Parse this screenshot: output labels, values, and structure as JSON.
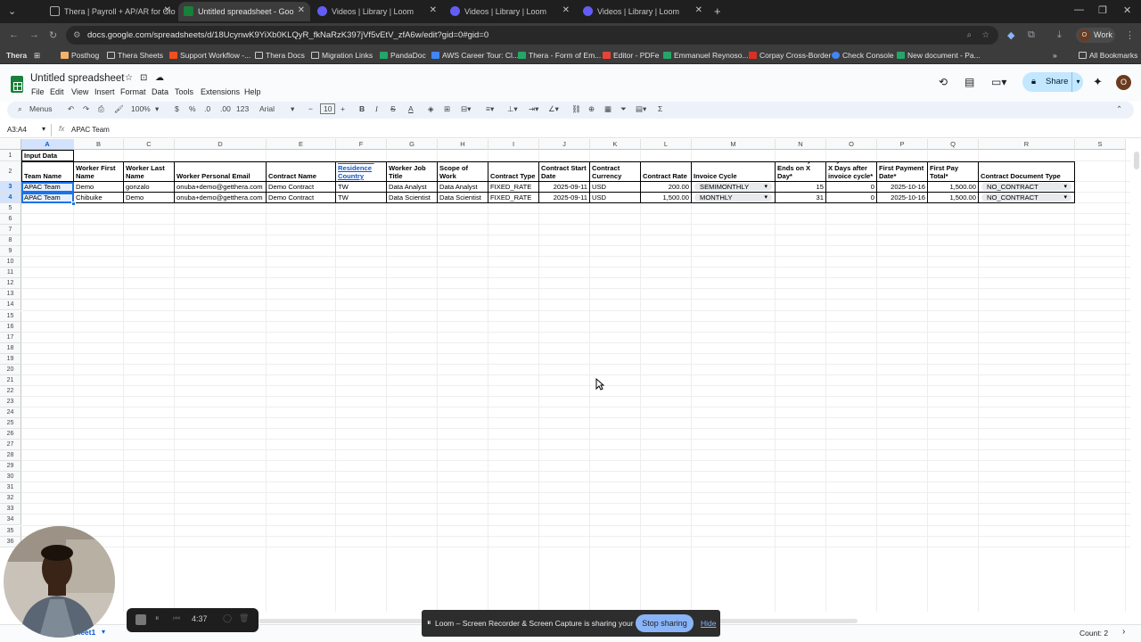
{
  "browser": {
    "tabs": [
      {
        "title": "Thera | Payroll + AP/AR for Glo",
        "active": false
      },
      {
        "title": "Untitled spreadsheet - Goo",
        "active": true
      },
      {
        "title": "Videos | Library | Loom",
        "active": false
      },
      {
        "title": "Videos | Library | Loom",
        "active": false
      },
      {
        "title": "Videos | Library | Loom",
        "active": false
      }
    ],
    "url": "docs.google.com/spreadsheets/d/18UcynwK9YiXb0KLQyR_fkNaRzK397jVf5vEtV_zfA6w/edit?gid=0#gid=0",
    "profile_label": "Work",
    "bookmarks": [
      "Posthog",
      "Thera Sheets",
      "Support Workflow -...",
      "Thera Docs",
      "Migration Links",
      "PandaDoc",
      "AWS Career Tour: Cl...",
      "Thera - Form of Em...",
      "Editor - PDFe",
      "Emmanuel Reynoso...",
      "Corpay Cross-Border",
      "Check Console",
      "New document - Pa..."
    ],
    "bookmarks_prefix": "Thera",
    "all_bookmarks": "All Bookmarks"
  },
  "sheets": {
    "doc_title": "Untitled spreadsheet",
    "menus": [
      "File",
      "Edit",
      "View",
      "Insert",
      "Format",
      "Data",
      "Tools",
      "Extensions",
      "Help"
    ],
    "share_label": "Share",
    "avatar_letter": "O",
    "toolbar": {
      "menus_label": "Menus",
      "zoom": "100%",
      "currency": "$",
      "percent": "%",
      "dec_decrease": ".0",
      "dec_increase": ".00",
      "number_format": "123",
      "font": "Arial",
      "font_size": "10"
    },
    "name_box": "A3:A4",
    "formula_value": "APAC Team",
    "columns": [
      "A",
      "B",
      "C",
      "D",
      "E",
      "F",
      "G",
      "H",
      "I",
      "J",
      "K",
      "L",
      "M",
      "N",
      "O",
      "P",
      "Q",
      "R",
      "S"
    ],
    "row_numbers": [
      "1",
      "2",
      "3",
      "4",
      "5",
      "6",
      "7",
      "8",
      "9",
      "10",
      "11",
      "12",
      "13",
      "14",
      "15",
      "16",
      "17",
      "18",
      "19",
      "20",
      "21",
      "22",
      "23",
      "24",
      "25",
      "26",
      "27",
      "28",
      "29",
      "30",
      "31",
      "32",
      "33",
      "34",
      "35",
      "36"
    ],
    "section_title": "Input Data",
    "headers": [
      "Team Name",
      "Worker First Name",
      "Worker Last Name",
      "Worker Personal Email",
      "Contract Name",
      "Worker Tax Residence Country",
      "Worker Job Title",
      "Scope of Work",
      "Contract Type",
      "Contract Start Date",
      "Contract Currency",
      "Contract Rate",
      "Invoice Cycle",
      "Invoice Cycle Ends on X Day*",
      "Payment Due X Days after invoice cycle*",
      "First Payment Date*",
      "First Pay Total*",
      "Contract Document Type"
    ],
    "rows": [
      [
        "APAC Team",
        "Demo",
        "gonzalo",
        "onuba+demo@getthera.com",
        "Demo Contract",
        "TW",
        "Data Analyst",
        "Data Analyst",
        "FIXED_RATE",
        "2025-09-11",
        "USD",
        "200.00",
        "SEMIMONTHLY",
        "15",
        "0",
        "2025-10-16",
        "1,500.00",
        "NO_CONTRACT"
      ],
      [
        "APAC Team",
        "Chibuike",
        "Demo",
        "onuba+demo@getthera.com",
        "Demo Contract",
        "TW",
        "Data Scientist",
        "Data Scientist",
        "FIXED_RATE",
        "2025-09-11",
        "USD",
        "1,500.00",
        "MONTHLY",
        "31",
        "0",
        "2025-10-16",
        "1,500.00",
        "NO_CONTRACT"
      ]
    ],
    "sheet_tab": "heet1",
    "count_label": "Count: 2"
  },
  "loom": {
    "sharing_text": "Loom – Screen Recorder & Screen Capture is sharing your screen.",
    "stop_label": "Stop sharing",
    "hide_label": "Hide",
    "timer": "4:37"
  }
}
